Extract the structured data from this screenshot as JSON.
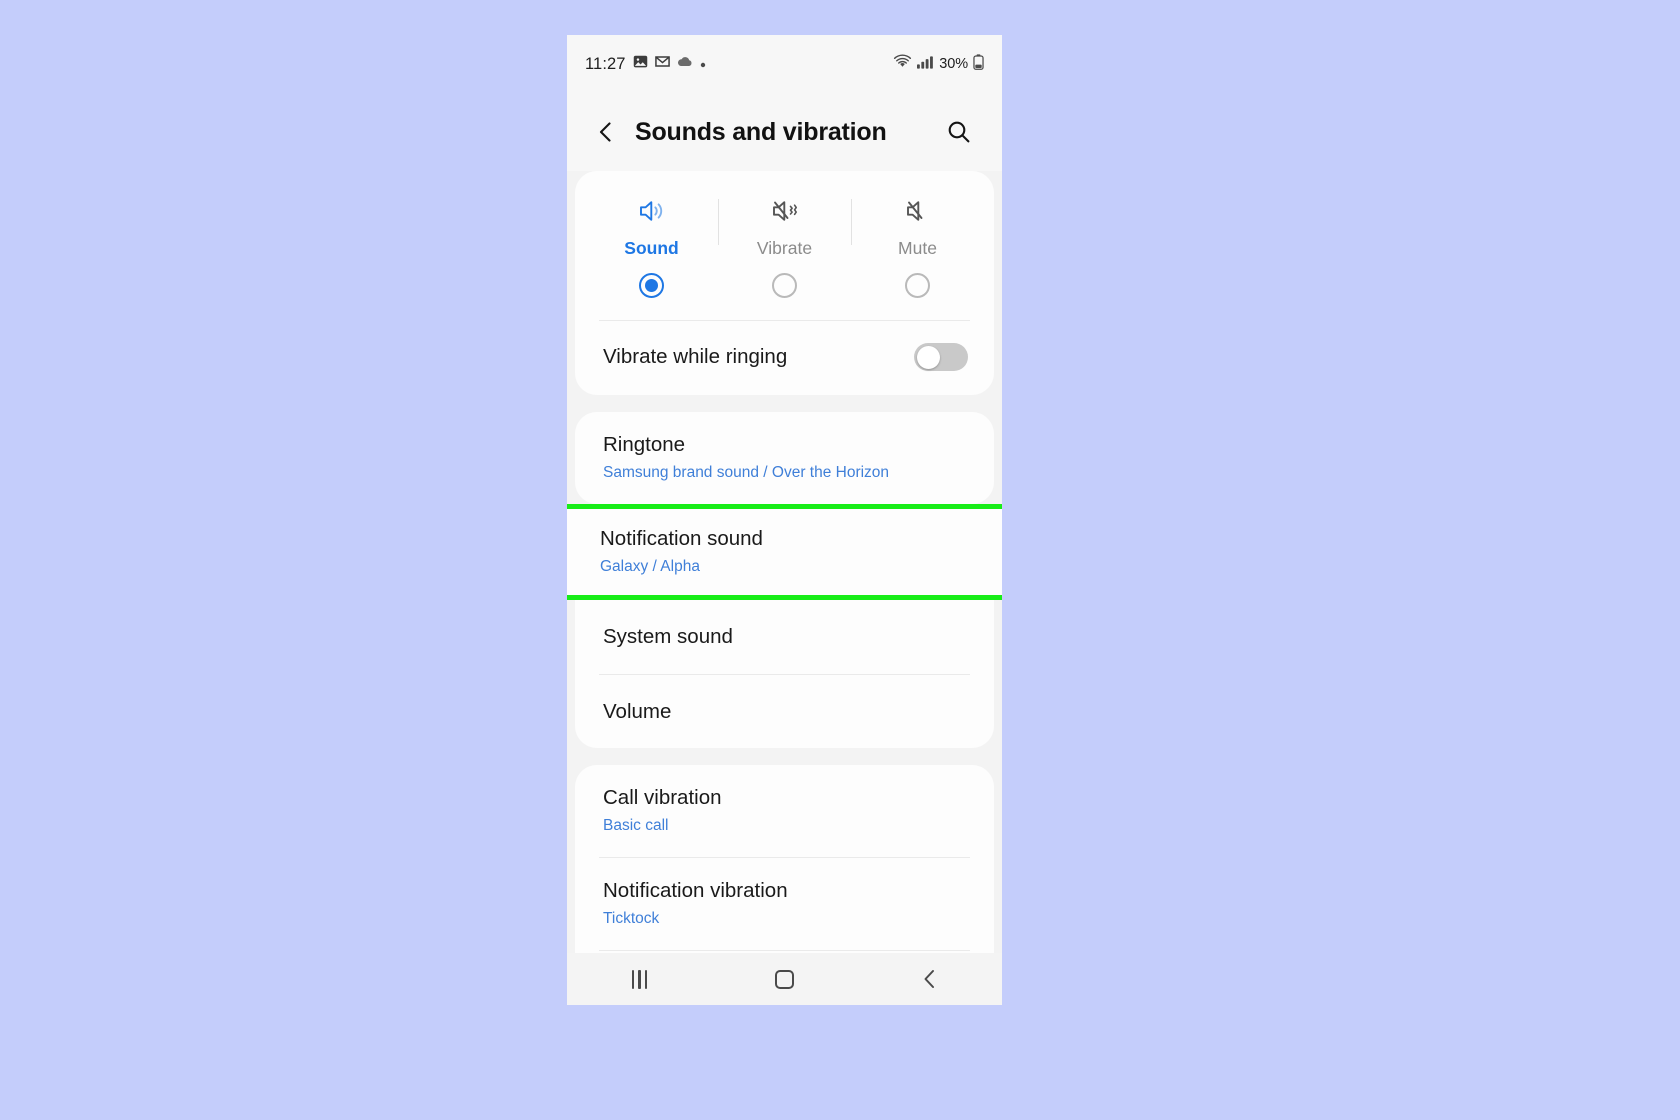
{
  "status_bar": {
    "time": "11:27",
    "icons": [
      "photo-icon",
      "gmail-icon",
      "cloud-icon",
      "dot-icon"
    ],
    "wifi_icon": "wifi-icon",
    "signal_icon": "cellular-signal-icon",
    "battery_text": "30%",
    "battery_icon": "battery-icon"
  },
  "header": {
    "back_icon": "chevron-left-icon",
    "title": "Sounds and vibration",
    "search_icon": "search-icon"
  },
  "mode_selector": {
    "options": [
      {
        "label": "Sound",
        "icon": "speaker-on-icon",
        "selected": true
      },
      {
        "label": "Vibrate",
        "icon": "speaker-vibrate-icon",
        "selected": false
      },
      {
        "label": "Mute",
        "icon": "speaker-mute-icon",
        "selected": false
      }
    ]
  },
  "vibrate_while_ringing": {
    "label": "Vibrate while ringing",
    "state": "off"
  },
  "groups": [
    {
      "rows": [
        {
          "title": "Ringtone",
          "subtitle": "Samsung brand sound / Over the Horizon",
          "highlighted": false
        },
        {
          "title": "Notification sound",
          "subtitle": "Galaxy / Alpha",
          "highlighted": true
        },
        {
          "title": "System sound",
          "subtitle": "",
          "highlighted": false
        },
        {
          "title": "Volume",
          "subtitle": "",
          "highlighted": false
        }
      ]
    },
    {
      "rows": [
        {
          "title": "Call vibration",
          "subtitle": "Basic call",
          "highlighted": false
        },
        {
          "title": "Notification vibration",
          "subtitle": "Ticktock",
          "highlighted": false
        }
      ]
    }
  ],
  "nav_bar": {
    "recents_icon": "recents-icon",
    "home_icon": "home-icon",
    "back_icon": "nav-back-icon"
  },
  "colors": {
    "page_background": "#c4cdfb",
    "accent_blue": "#1e77e4",
    "subtitle_blue": "#3f7fd8",
    "highlight_green": "#17ed17",
    "card": "#fdfdfd",
    "screen_background": "#f3f3f3"
  }
}
